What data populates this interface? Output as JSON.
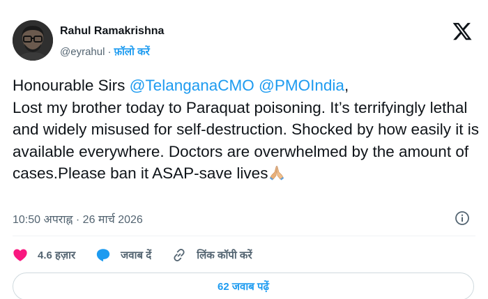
{
  "author": {
    "name": "Rahul Ramakrishna",
    "handle": "@eyrahul",
    "separator": "·",
    "follow_label": "फ़ॉलो करें"
  },
  "tweet": {
    "line1_prefix": "Honourable Sirs ",
    "mention1": "@TelanganaCMO",
    "mention2": "@PMOIndia",
    "line1_suffix": ",",
    "body": "Lost my brother today to Paraquat poisoning. It’s terrifyingly lethal and widely misused for self-destruction. Shocked by how easily it is available everywhere. Doctors are overwhelmed by the amount of cases.Please ban it ASAP-save lives",
    "emoji": "folded-hands"
  },
  "timestamp": {
    "time": "10:50 अपराह्न",
    "separator": "·",
    "date": "26 मार्च 2026"
  },
  "actions": {
    "like_count": "4.6 हज़ार",
    "reply_label": "जवाब दें",
    "copy_link_label": "लिंक कॉपी करें"
  },
  "replies_button": {
    "label": "62 जवाब पढ़ें"
  },
  "colors": {
    "accent": "#1d9bf0",
    "like": "#f91880",
    "text": "#0f1419",
    "muted": "#536471"
  }
}
